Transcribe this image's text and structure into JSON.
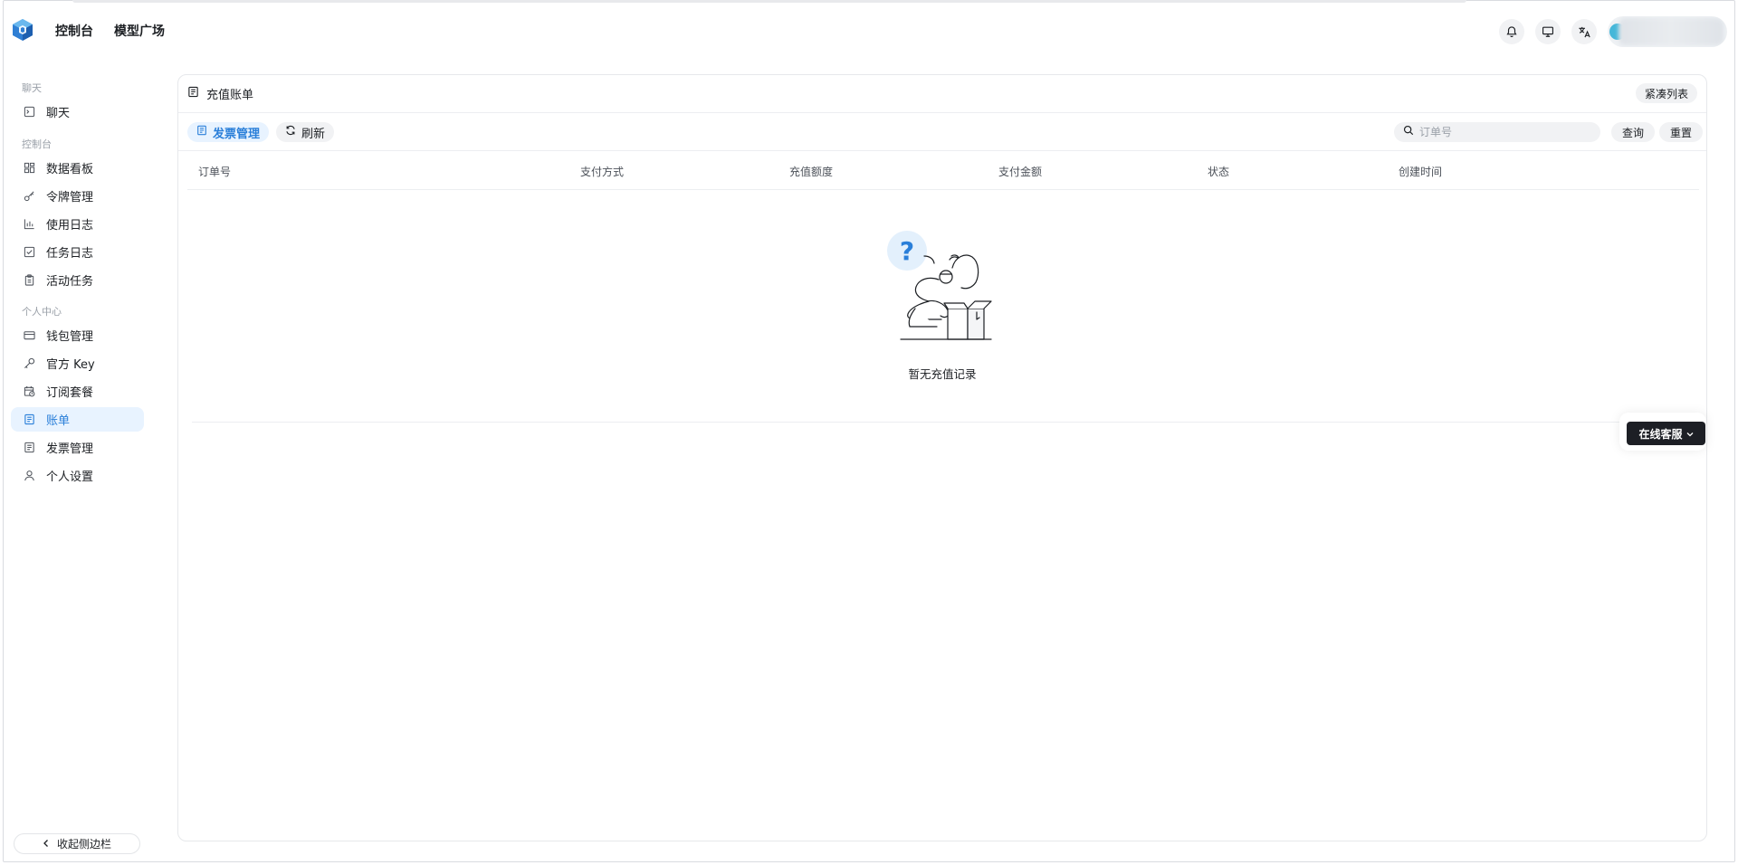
{
  "header": {
    "nav": [
      {
        "label": "控制台"
      },
      {
        "label": "模型广场"
      }
    ],
    "icons": [
      "bell-icon",
      "monitor-icon",
      "translate-icon"
    ]
  },
  "sidebar": {
    "groups": [
      {
        "label": "聊天"
      },
      {
        "label": "控制台"
      },
      {
        "label": "个人中心"
      }
    ],
    "items": [
      {
        "label": "聊天",
        "icon": "chat-icon"
      },
      {
        "label": "数据看板",
        "icon": "dashboard-icon"
      },
      {
        "label": "令牌管理",
        "icon": "key-icon"
      },
      {
        "label": "使用日志",
        "icon": "bar-chart-icon"
      },
      {
        "label": "任务日志",
        "icon": "checkbox-icon"
      },
      {
        "label": "活动任务",
        "icon": "clipboard-icon"
      },
      {
        "label": "钱包管理",
        "icon": "wallet-icon"
      },
      {
        "label": "官方 Key",
        "icon": "key-outline-icon"
      },
      {
        "label": "订阅套餐",
        "icon": "calendar-clock-icon"
      },
      {
        "label": "账单",
        "icon": "bill-icon",
        "active": true
      },
      {
        "label": "发票管理",
        "icon": "invoice-icon"
      },
      {
        "label": "个人设置",
        "icon": "user-icon"
      }
    ],
    "collapse_label": "收起侧边栏"
  },
  "main": {
    "title": "充值账单",
    "compact_label": "紧凑列表",
    "toolbar": {
      "invoice_label": "发票管理",
      "refresh_label": "刷新",
      "search_placeholder": "订单号",
      "query_label": "查询",
      "reset_label": "重置"
    },
    "table": {
      "columns": [
        "订单号",
        "支付方式",
        "充值额度",
        "支付金额",
        "状态",
        "创建时间"
      ],
      "rows": [],
      "empty_text": "暂无充值记录"
    }
  },
  "support": {
    "label": "在线客服"
  },
  "colors": {
    "accent": "#2a7fd9",
    "active_bg": "#e8f3ff",
    "support_bg": "#1d1f25"
  }
}
